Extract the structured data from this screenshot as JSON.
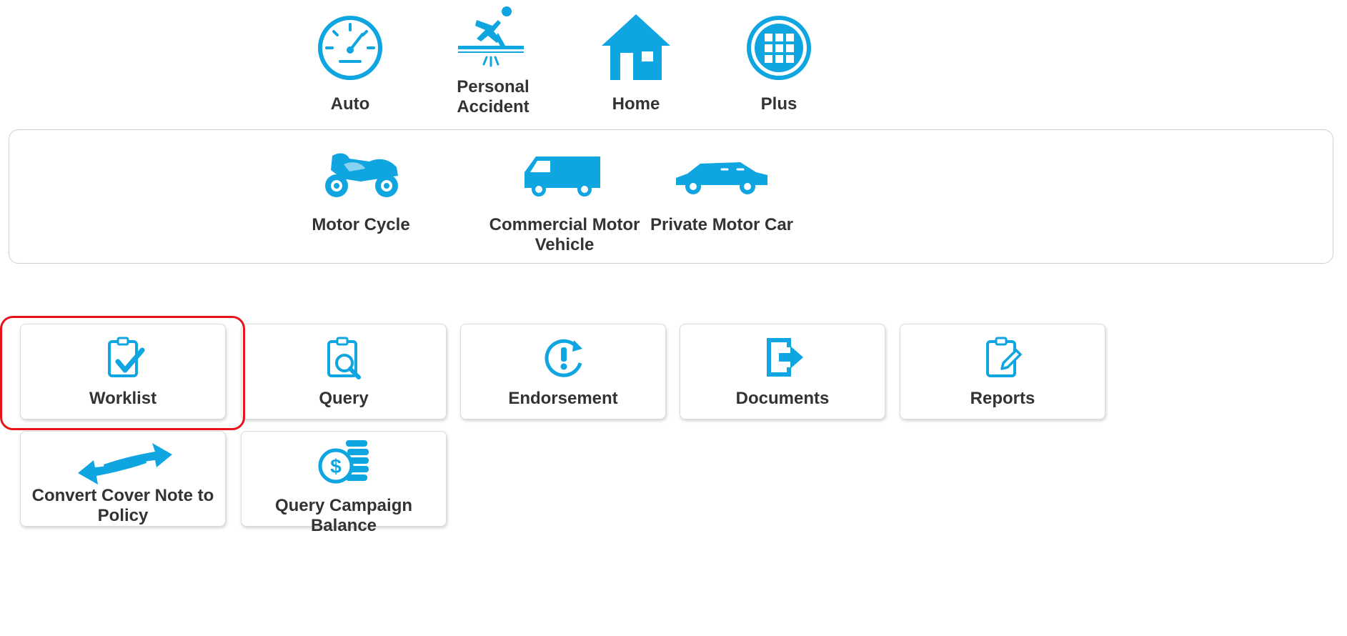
{
  "products": [
    {
      "label": "Auto",
      "icon": "speedometer-icon"
    },
    {
      "label": "Personal\nAccident",
      "icon": "slip-fall-icon"
    },
    {
      "label": "Home",
      "icon": "house-icon"
    },
    {
      "label": "Plus",
      "icon": "grid-icon"
    }
  ],
  "auto_types": [
    {
      "label": "Motor Cycle",
      "icon": "motorcycle-icon"
    },
    {
      "label": "Commercial Motor\nVehicle",
      "icon": "van-icon"
    },
    {
      "label": "Private Motor Car",
      "icon": "car-icon"
    }
  ],
  "actions": [
    {
      "label": "Worklist",
      "icon": "clipboard-check-icon"
    },
    {
      "label": "Query",
      "icon": "clipboard-search-icon"
    },
    {
      "label": "Endorsement",
      "icon": "refresh-alert-icon"
    },
    {
      "label": "Documents",
      "icon": "document-exit-icon"
    },
    {
      "label": "Reports",
      "icon": "clipboard-pencil-icon"
    },
    {
      "label": "Convert Cover Note to\nPolicy",
      "icon": "swap-arrows-icon"
    },
    {
      "label": "Query Campaign Balance",
      "icon": "coins-dollar-icon"
    }
  ],
  "colors": {
    "accent": "#0ea5e0",
    "highlight": "#e8141b",
    "text": "#333333"
  }
}
